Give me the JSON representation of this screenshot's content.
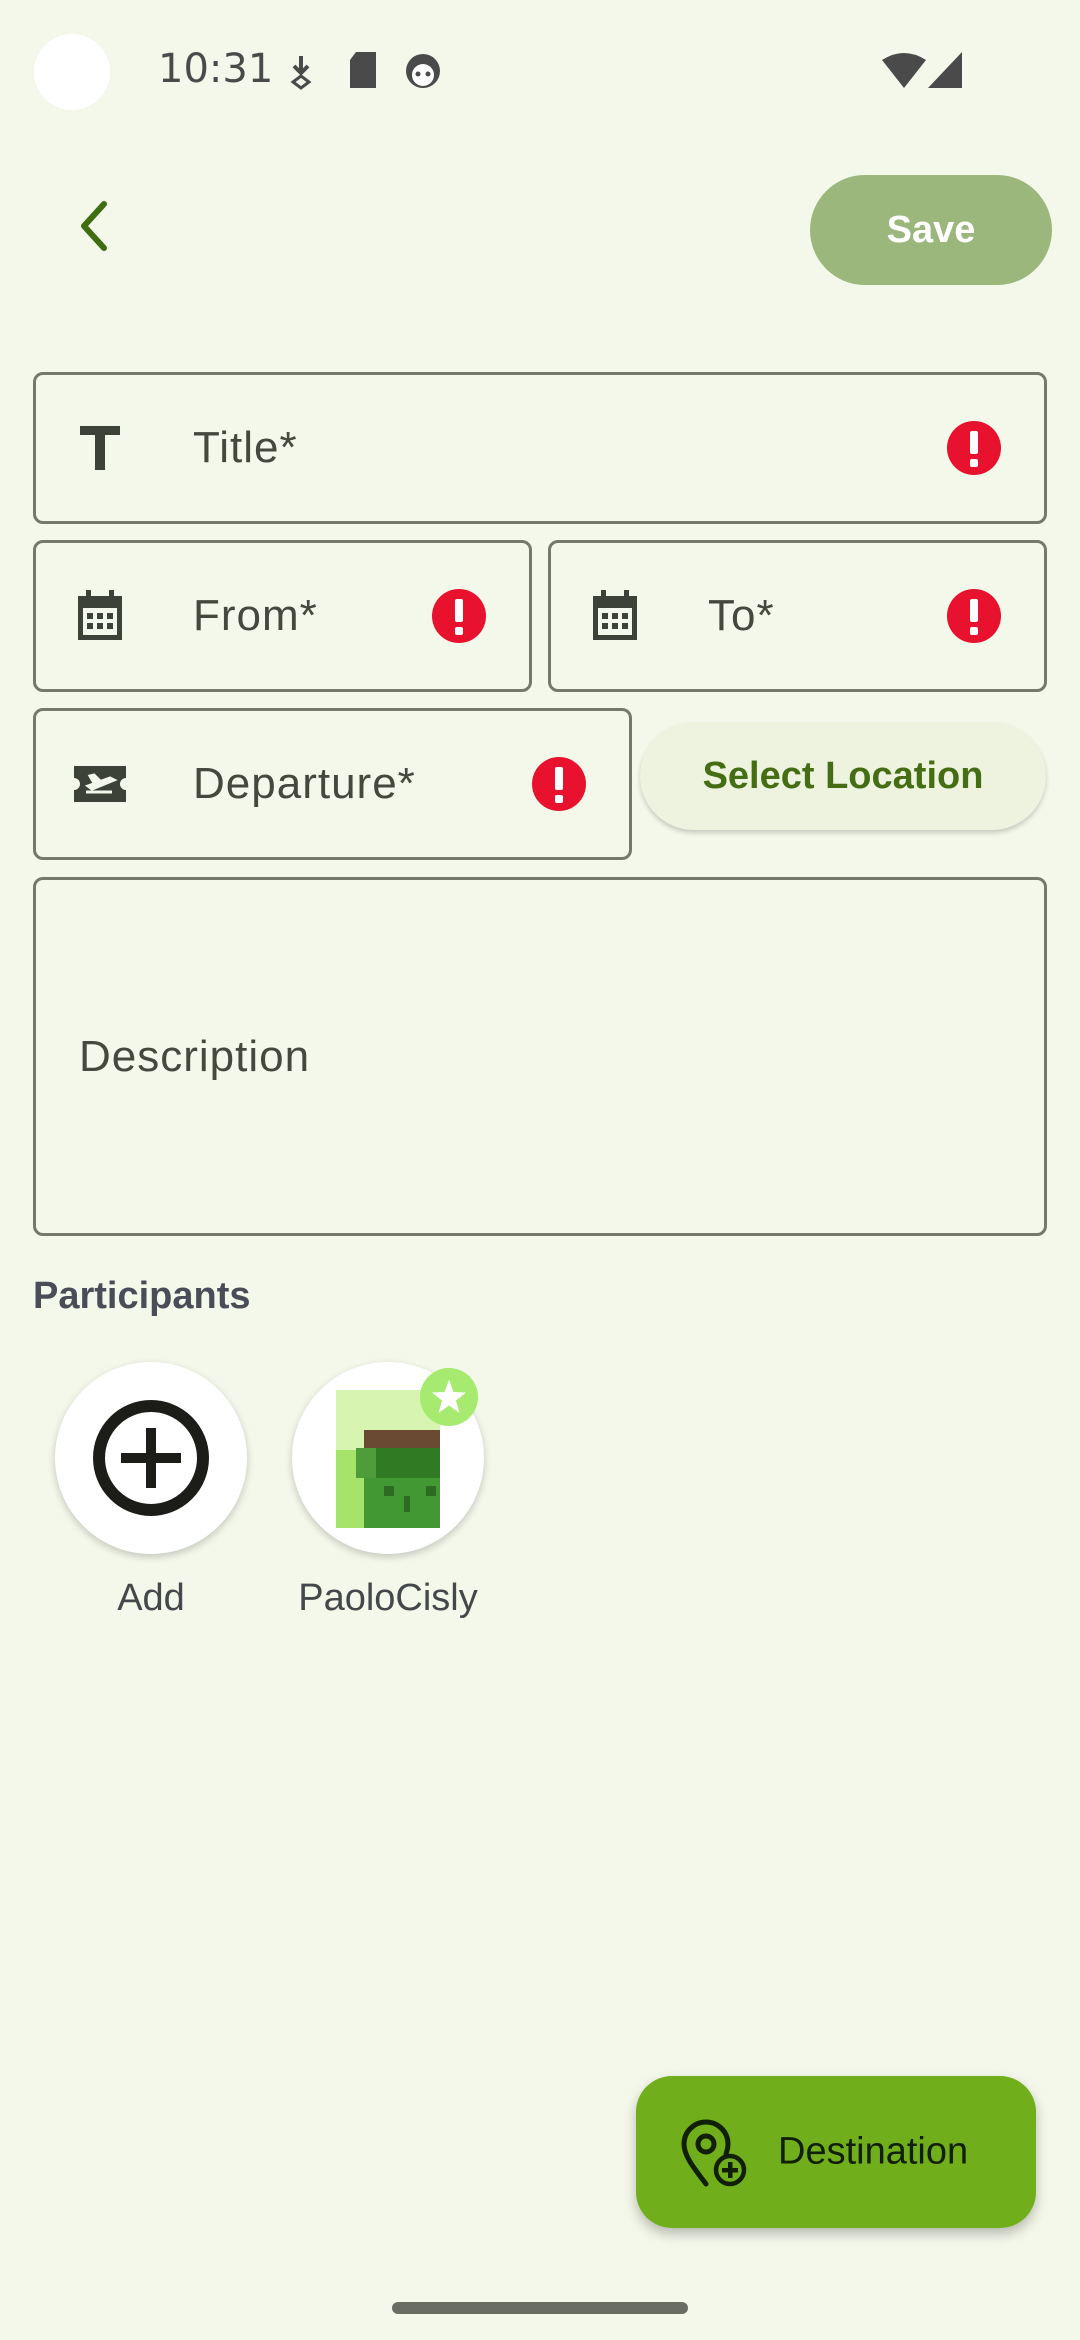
{
  "status_bar": {
    "time": "10:31",
    "icons": [
      "download-arrow-icon",
      "sd-card-icon",
      "robot-face-icon",
      "wifi-icon",
      "cell-signal-icon"
    ]
  },
  "app_bar": {
    "back_icon": "chevron-left-icon",
    "save_label": "Save"
  },
  "form": {
    "title": {
      "label": "Title*",
      "icon": "text-format-icon",
      "error": true
    },
    "from": {
      "label": "From*",
      "icon": "calendar-icon",
      "error": true
    },
    "to": {
      "label": "To*",
      "icon": "calendar-icon",
      "error": true
    },
    "departure": {
      "label": "Departure*",
      "icon": "flight-takeoff-icon",
      "error": true
    },
    "select_location_label": "Select Location",
    "description": {
      "label": "Description"
    }
  },
  "participants": {
    "title": "Participants",
    "items": [
      {
        "name": "Add",
        "icon": "add-circle-icon"
      },
      {
        "name": "PaoloCisly",
        "icon": "pixel-avatar",
        "badge": "star-icon"
      }
    ]
  },
  "fab": {
    "label": "Destination",
    "icon": "add-location-icon"
  },
  "colors": {
    "background": "#f4f8ea",
    "primary": "#70ae1b",
    "error": "#e8122f",
    "save_button": "#9bb77b",
    "accent_text": "#456d14"
  }
}
